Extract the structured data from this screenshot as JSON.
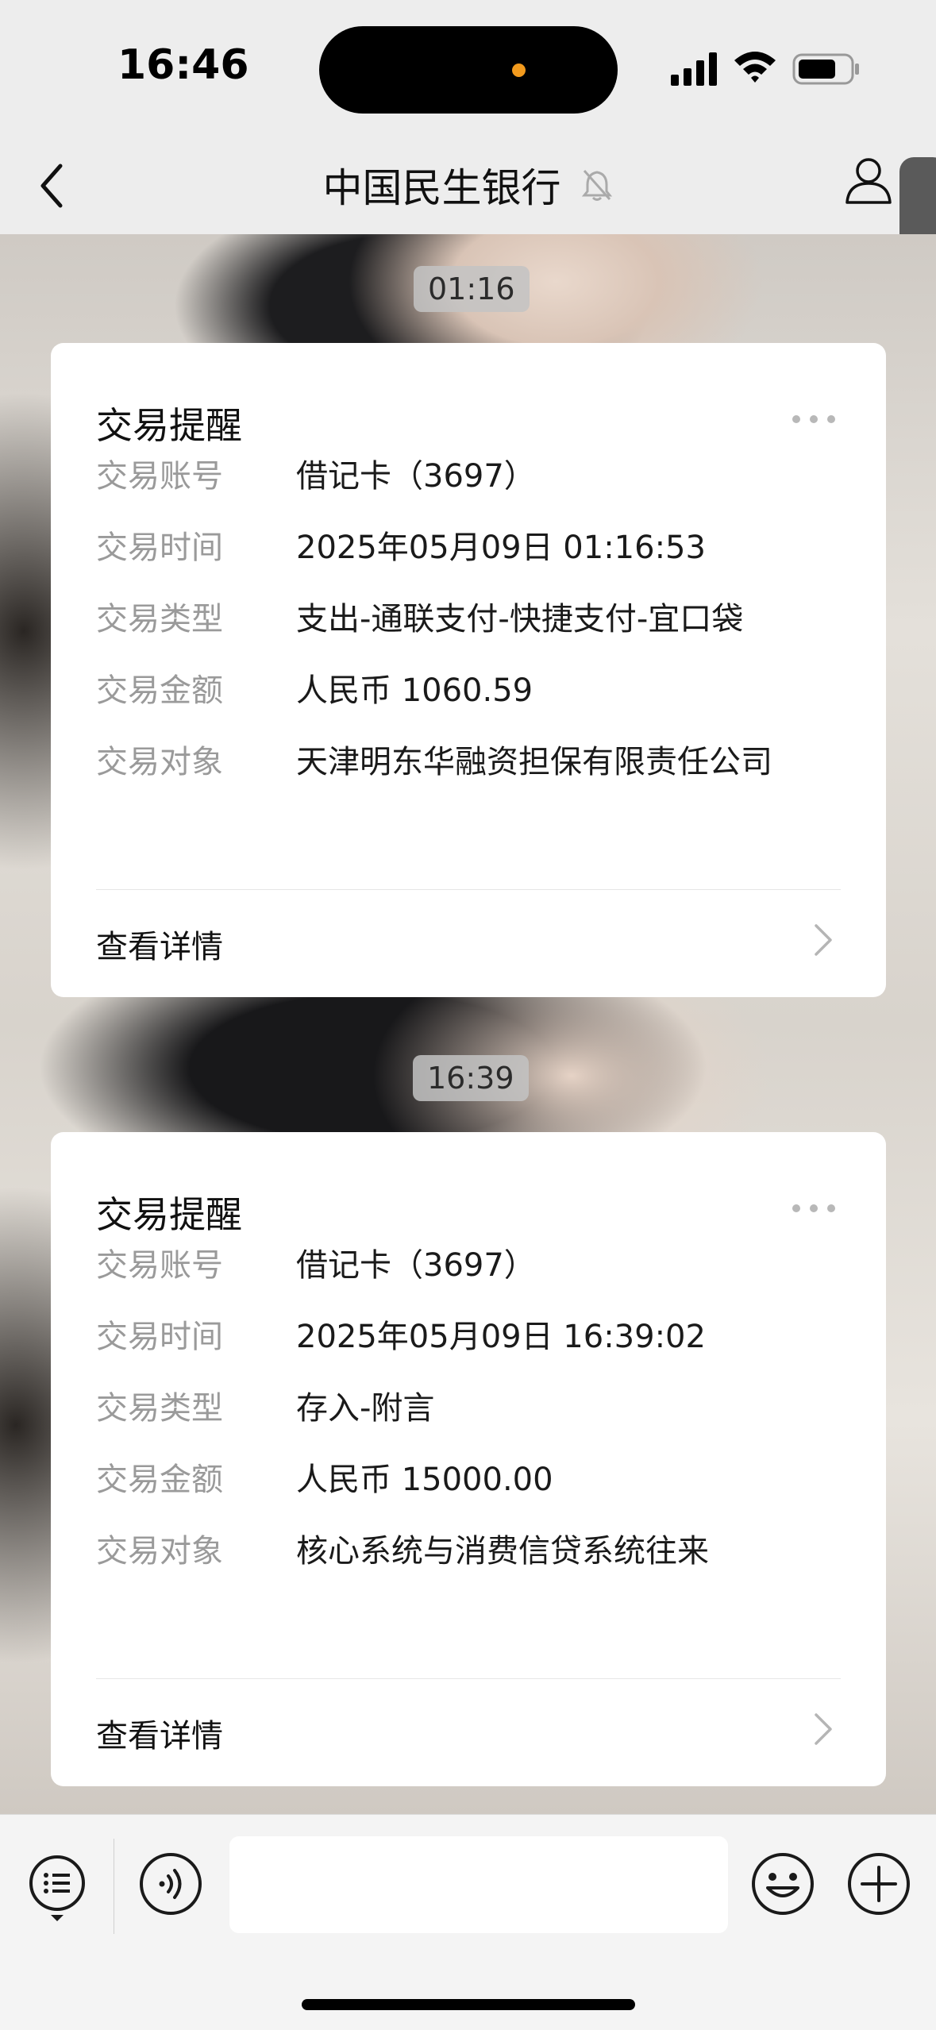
{
  "status_bar": {
    "time": "16:46"
  },
  "nav": {
    "title": "中国民生银行"
  },
  "messages": [
    {
      "time": "01:16",
      "card": {
        "title": "交易提醒",
        "rows": [
          {
            "label": "交易账号",
            "value": "借记卡（3697）"
          },
          {
            "label": "交易时间",
            "value": "2025年05月09日 01:16:53"
          },
          {
            "label": "交易类型",
            "value": "支出-通联支付-快捷支付-宜口袋"
          },
          {
            "label": "交易金额",
            "value": "人民币 1060.59"
          },
          {
            "label": "交易对象",
            "value": "天津明东华融资担保有限责任公司"
          }
        ],
        "detail_label": "查看详情"
      }
    },
    {
      "time": "16:39",
      "card": {
        "title": "交易提醒",
        "rows": [
          {
            "label": "交易账号",
            "value": "借记卡（3697）"
          },
          {
            "label": "交易时间",
            "value": "2025年05月09日 16:39:02"
          },
          {
            "label": "交易类型",
            "value": "存入-附言"
          },
          {
            "label": "交易金额",
            "value": "人民币 15000.00"
          },
          {
            "label": "交易对象",
            "value": "核心系统与消费信贷系统往来"
          }
        ],
        "detail_label": "查看详情"
      }
    }
  ],
  "input": {
    "placeholder": ""
  },
  "icons": {
    "back": "chevron-left-icon",
    "mute": "bell-off-icon",
    "profile": "person-icon",
    "more": "more-dots-icon",
    "menu": "menu-list-icon",
    "voice": "voice-icon",
    "emoji": "emoji-icon",
    "plus": "plus-icon"
  }
}
